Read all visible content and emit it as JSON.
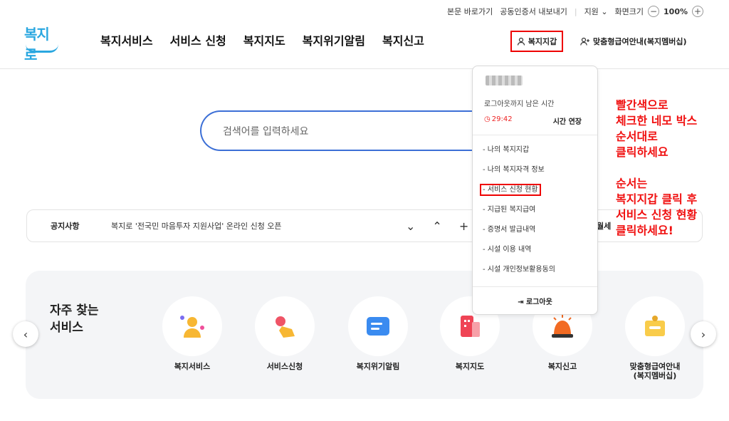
{
  "utility": {
    "skip": "본문 바로가기",
    "cert": "공동인증서 내보내기",
    "support": "지원",
    "zoom_label": "화면크기",
    "zoom_value": "100%"
  },
  "header": {
    "logo": "복지로",
    "nav": [
      "복지서비스",
      "서비스 신청",
      "복지지도",
      "복지위기알림",
      "복지신고"
    ],
    "wallet": "복지지갑",
    "member": "맞춤형급여안내(복지멤버십)"
  },
  "search": {
    "placeholder": "검색어를 입력하세요"
  },
  "notice": {
    "label": "공지사항",
    "text": "복지로 '전국민 마음투자 지원사업' 온라인 신청 오픈",
    "more": "월세"
  },
  "frequent": {
    "title": "자주 찾는\n서비스",
    "items": [
      "복지서비스",
      "서비스신청",
      "복지위기알림",
      "복지지도",
      "복지신고",
      "맞춤형급여안내\n(복지멤버십)"
    ]
  },
  "dropdown": {
    "remain_label": "로그아웃까지 남은 시간",
    "timer": "29:42",
    "extend": "시간 연장",
    "menu": [
      "- 나의 복지지갑",
      "- 나의 복지자격 정보",
      "- 서비스 신청 현황",
      "- 지급된 복지급여",
      "- 증명서 발급내역",
      "- 시설 이용 내역",
      "- 시설 개인정보활용동의"
    ],
    "logout": "로그아웃"
  },
  "instruction": "빨간색으로\n체크한 네모 박스\n순서대로\n클릭하세요\n\n순서는\n복지지갑 클릭 후\n서비스 신청 현황\n클릭하세요!",
  "colors": {
    "accent": "#3c6fd6",
    "highlight": "#e00000",
    "timer": "#e22222"
  }
}
